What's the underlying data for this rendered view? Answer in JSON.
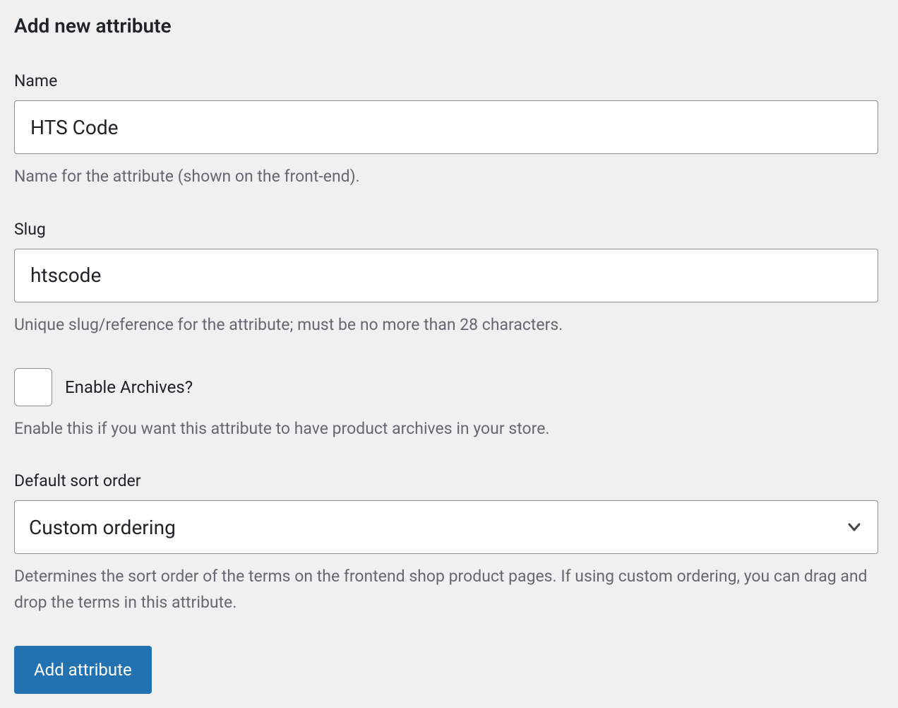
{
  "form": {
    "title": "Add new attribute",
    "name": {
      "label": "Name",
      "value": "HTS Code",
      "help": "Name for the attribute (shown on the front-end)."
    },
    "slug": {
      "label": "Slug",
      "value": "htscode",
      "help": "Unique slug/reference for the attribute; must be no more than 28 characters."
    },
    "archives": {
      "label": "Enable Archives?",
      "checked": false,
      "help": "Enable this if you want this attribute to have product archives in your store."
    },
    "sort_order": {
      "label": "Default sort order",
      "selected": "Custom ordering",
      "help": "Determines the sort order of the terms on the frontend shop product pages. If using custom ordering, you can drag and drop the terms in this attribute."
    },
    "submit_label": "Add attribute"
  }
}
